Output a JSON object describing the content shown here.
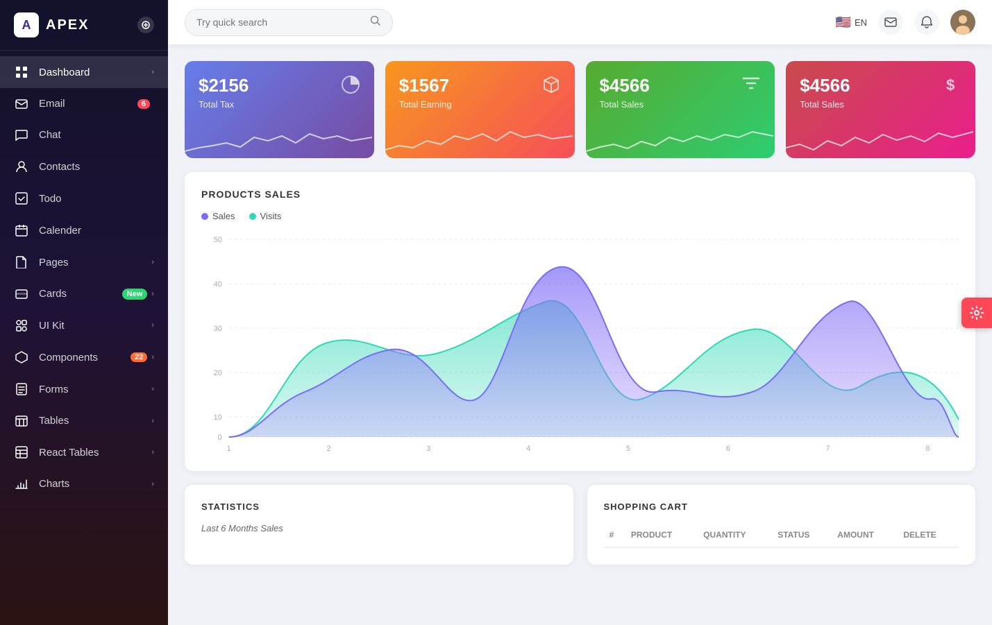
{
  "app": {
    "name": "APEX"
  },
  "sidebar": {
    "toggle_icon": "≡",
    "items": [
      {
        "id": "dashboard",
        "label": "Dashboard",
        "icon": "⊞",
        "has_arrow": true,
        "badge": null
      },
      {
        "id": "email",
        "label": "Email",
        "icon": "✉",
        "has_arrow": false,
        "badge": "6",
        "badge_type": "red"
      },
      {
        "id": "chat",
        "label": "Chat",
        "icon": "💬",
        "has_arrow": false,
        "badge": null
      },
      {
        "id": "contacts",
        "label": "Contacts",
        "icon": "👤",
        "has_arrow": false,
        "badge": null
      },
      {
        "id": "todo",
        "label": "Todo",
        "icon": "✓",
        "has_arrow": false,
        "badge": null
      },
      {
        "id": "calender",
        "label": "Calender",
        "icon": "📅",
        "has_arrow": false,
        "badge": null
      },
      {
        "id": "pages",
        "label": "Pages",
        "icon": "📄",
        "has_arrow": true,
        "badge": null
      },
      {
        "id": "cards",
        "label": "Cards",
        "icon": "🃏",
        "has_arrow": true,
        "badge": "New",
        "badge_type": "new"
      },
      {
        "id": "ui-kit",
        "label": "UI Kit",
        "icon": "🎨",
        "has_arrow": true,
        "badge": null
      },
      {
        "id": "components",
        "label": "Components",
        "icon": "⚡",
        "has_arrow": true,
        "badge": "22",
        "badge_type": "orange"
      },
      {
        "id": "forms",
        "label": "Forms",
        "icon": "📝",
        "has_arrow": true,
        "badge": null
      },
      {
        "id": "tables",
        "label": "Tables",
        "icon": "⊟",
        "has_arrow": true,
        "badge": null
      },
      {
        "id": "react-tables",
        "label": "React Tables",
        "icon": "⊞",
        "has_arrow": true,
        "badge": null
      },
      {
        "id": "charts",
        "label": "Charts",
        "icon": "📊",
        "has_arrow": true,
        "badge": null
      }
    ]
  },
  "header": {
    "search_placeholder": "Try quick search",
    "lang": "EN",
    "flag": "🇺🇸"
  },
  "stat_cards": [
    {
      "id": "total-tax",
      "value": "$2156",
      "label": "Total Tax",
      "icon": "◎",
      "color": "blue"
    },
    {
      "id": "total-earning",
      "value": "$1567",
      "label": "Total Earning",
      "icon": "⬡",
      "color": "red"
    },
    {
      "id": "total-sales-1",
      "value": "$4566",
      "label": "Total Sales",
      "icon": "◈",
      "color": "green"
    },
    {
      "id": "total-sales-2",
      "value": "$4566",
      "label": "Total Sales",
      "icon": "$",
      "color": "pink"
    }
  ],
  "products_chart": {
    "title": "PRODUCTS SALES",
    "legend": [
      {
        "label": "Sales",
        "color": "#7b6cf6"
      },
      {
        "label": "Visits",
        "color": "#2ed8b4"
      }
    ],
    "y_labels": [
      "50",
      "40",
      "30",
      "20",
      "10",
      "0"
    ],
    "x_labels": [
      "1",
      "2",
      "3",
      "4",
      "5",
      "6",
      "7",
      "8"
    ]
  },
  "statistics": {
    "title": "STATISTICS",
    "sub_label": "Last 6 Months Sales"
  },
  "shopping_cart": {
    "title": "SHOPPING CART",
    "columns": [
      "#",
      "Product",
      "Quantity",
      "Status",
      "Amount",
      "Delete"
    ],
    "rows": []
  },
  "settings_fab": {
    "icon": "⚙"
  }
}
